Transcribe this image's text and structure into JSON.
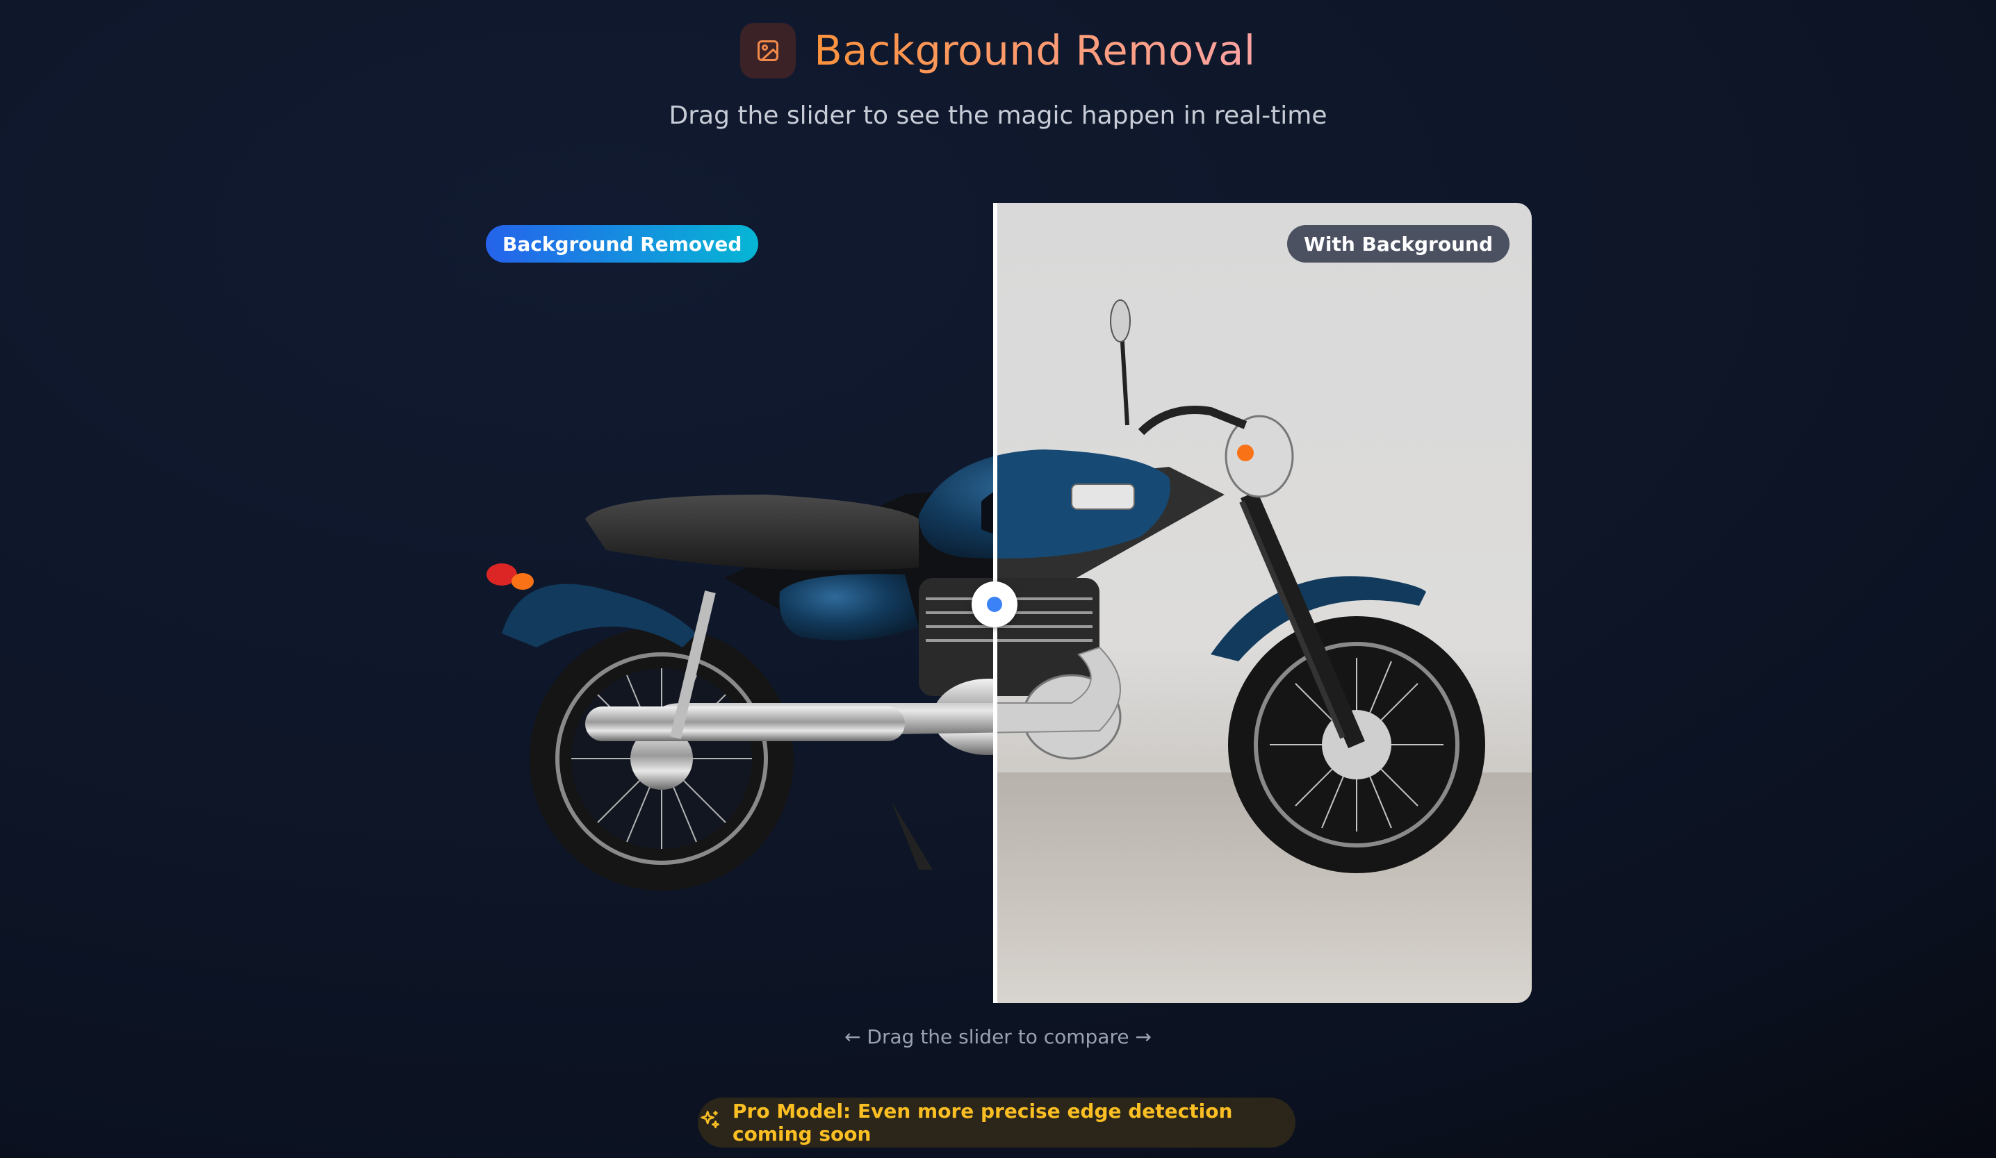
{
  "header": {
    "title": "Background Removal",
    "subtitle": "Drag the slider to see the magic happen in real-time",
    "icon": "image-icon"
  },
  "comparison": {
    "left_label": "Background Removed",
    "right_label": "With Background",
    "slider_position_percent": 49.4,
    "handle_color": "#3b82f6"
  },
  "hint": "← Drag the slider to compare →",
  "pro_banner": {
    "icon": "sparkles-icon",
    "text": "Pro Model: Even more precise edge detection coming soon"
  },
  "colors": {
    "accent": "#3b82f6",
    "title_gradient_start": "#fb923c",
    "title_gradient_end": "#fda4a4",
    "pro_text": "#fbbf24"
  }
}
